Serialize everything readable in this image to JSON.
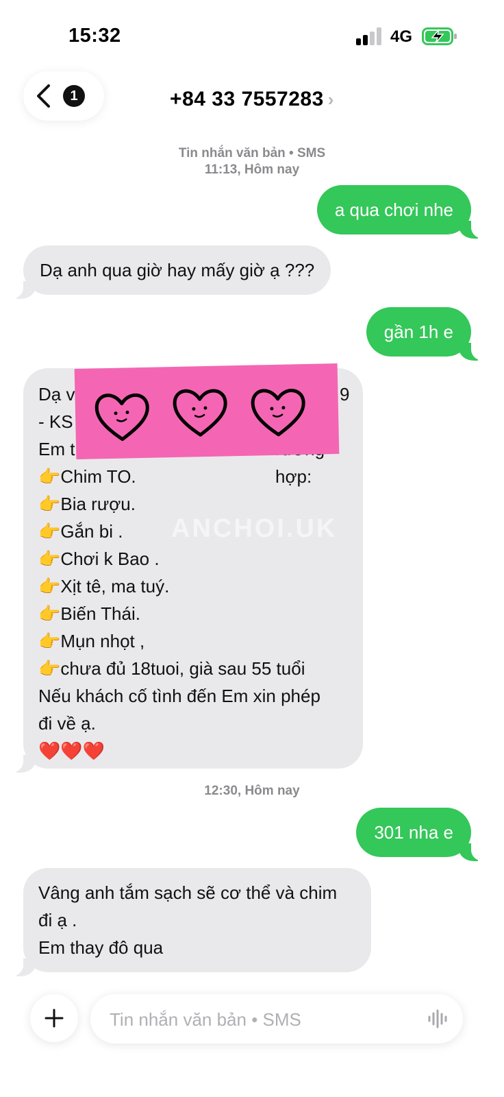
{
  "status_bar": {
    "time": "15:32",
    "network": "4G"
  },
  "header": {
    "back_badge": "1",
    "contact": "+84 33 7557283"
  },
  "conversation": {
    "meta1_line1": "Tin nhắn văn bản • SMS",
    "meta1_line2": "11:13, Hôm nay",
    "meta2": "12:30, Hôm nay",
    "messages": [
      {
        "from": "me",
        "lines": [
          "a qua chơi nhe"
        ]
      },
      {
        "from": "them",
        "lines": [
          "Dạ anh qua giờ hay mấy giờ ạ ???"
        ]
      },
      {
        "from": "me",
        "lines": [
          "gần 1h e"
        ]
      },
      {
        "from": "them",
        "lines": [
          "Dạ v",
          "- KS",
          "Em t",
          "👉Chim TO.",
          "👉Bia rượu.",
          "👉Gắn bi .",
          "👉Chơi k Bao .",
          "👉Xịt tê, ma tuý.",
          "👉Biến Thái.",
          "👉Mụn nhọt ,",
          "👉chưa đủ 18tuoi, già sau 55 tuổi",
          "Nếu khách cố tình đến Em xin phép",
          "đi về ạ.",
          "❤️❤️❤️"
        ],
        "partial_right": {
          "line1_end": "9",
          "line3_end": "rường hợp:"
        }
      },
      {
        "from": "me",
        "lines": [
          "301 nha e"
        ]
      },
      {
        "from": "them",
        "lines": [
          "Vâng anh tắm sạch sẽ cơ thể và chim",
          "đi ạ .",
          "Em thay đô qua"
        ]
      }
    ],
    "watermark": "ANCHOI.UK"
  },
  "composer": {
    "placeholder": "Tin nhắn văn bản • SMS"
  },
  "colors": {
    "outgoing": "#34c759",
    "incoming": "#e9e9eb",
    "sticker": "#f466b4"
  },
  "icons": [
    "signal-icon",
    "battery-charging-icon",
    "chevron-left-icon",
    "chevron-right-icon",
    "heart-face-icon",
    "plus-icon",
    "audio-wave-icon"
  ]
}
